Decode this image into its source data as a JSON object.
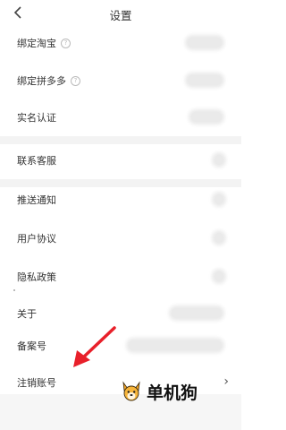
{
  "header": {
    "title": "设置",
    "back_icon": "chevron-left-icon"
  },
  "rows": [
    {
      "label": "绑定淘宝",
      "has_help": true
    },
    {
      "label": "绑定拼多多",
      "has_help": true
    },
    {
      "label": "实名认证"
    },
    {
      "label": "联系客服"
    },
    {
      "label": "推送通知"
    },
    {
      "label": "用户协议"
    },
    {
      "label": "隐私政策"
    },
    {
      "label": "关于"
    },
    {
      "label": "备案号"
    },
    {
      "label": "注销账号"
    }
  ],
  "help_glyph": "?",
  "chevron": "›",
  "watermark": {
    "text": "单机狗"
  },
  "colors": {
    "annotation_arrow": "#e8202a",
    "separator": "#f3f3f3"
  }
}
